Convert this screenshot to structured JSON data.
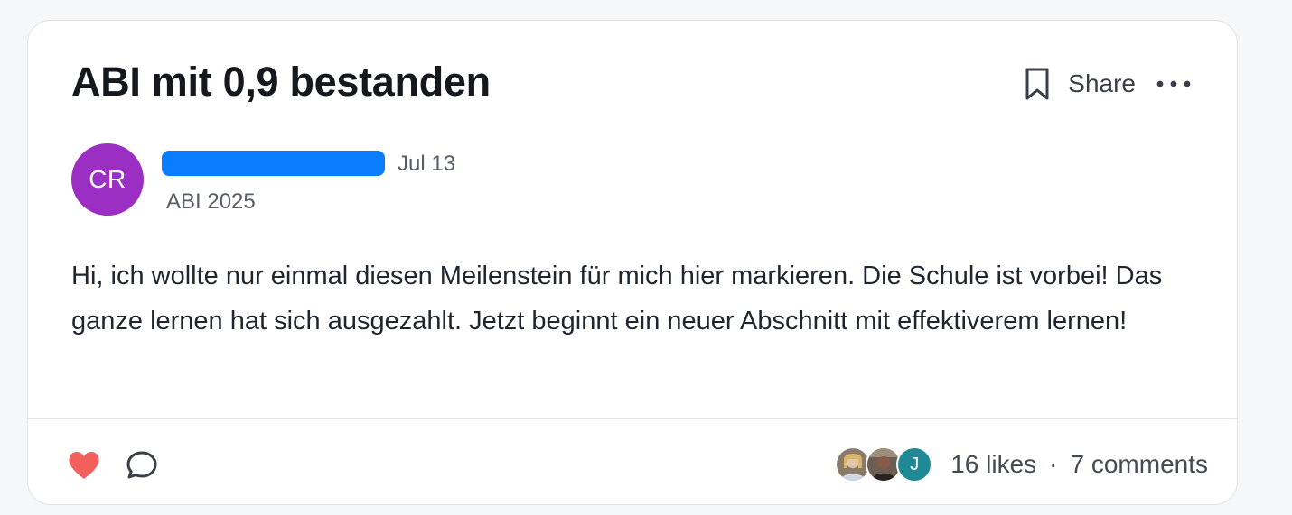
{
  "post": {
    "title": "ABI mit 0,9 bestanden",
    "author": {
      "initials": "CR",
      "avatar_color": "#9b2fc4",
      "name_redacted_color": "#0a7cff",
      "group": "ABI 2025"
    },
    "date": "Jul 13",
    "body": "Hi, ich wollte nur einmal diesen Meilenstein für mich hier markieren. Die Schule ist vorbei! Das ganze lernen hat sich ausgezahlt. Jetzt beginnt ein neuer Abschnitt mit effektiverem lernen!"
  },
  "actions": {
    "bookmark_icon": "bookmark-icon",
    "share_label": "Share",
    "more_icon": "more-horizontal-icon"
  },
  "footer": {
    "like_icon": "heart-icon",
    "like_color": "#f25f5c",
    "comment_icon": "comment-bubble-icon",
    "likers": [
      {
        "type": "photo"
      },
      {
        "type": "photo"
      },
      {
        "type": "letter",
        "letter": "J",
        "color": "#1f8a96"
      }
    ],
    "likes_text": "16 likes",
    "separator": "·",
    "comments_text": "7 comments"
  }
}
